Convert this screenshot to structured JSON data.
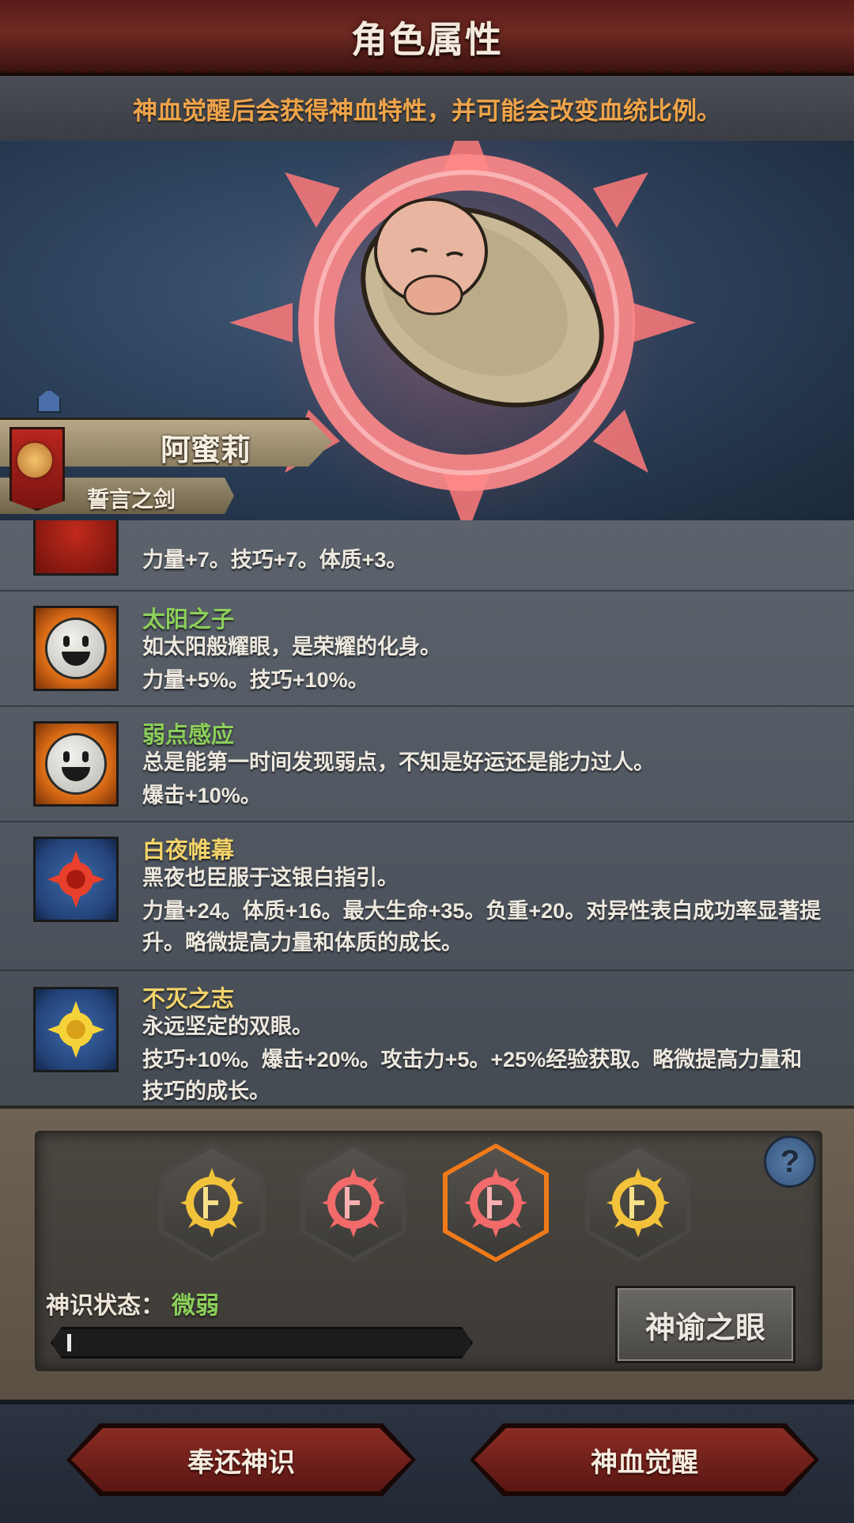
{
  "header": {
    "title": "角色属性"
  },
  "notice": {
    "text": "神血觉醒后会获得神血特性，并可能会改变血统比例。"
  },
  "character": {
    "name": "阿蜜莉",
    "title": "誓言之剑"
  },
  "traits": [
    {
      "name": "",
      "desc": "",
      "effect": "力量+7。技巧+7。体质+3。",
      "icon": "red-crest-icon"
    },
    {
      "name": "太阳之子",
      "desc": "如太阳般耀眼，是荣耀的化身。",
      "effect": "力量+5%。技巧+10%。",
      "icon": "smiley-sun-icon",
      "name_color": "#8ccf5a"
    },
    {
      "name": "弱点感应",
      "desc": "总是能第一时间发现弱点，不知是好运还是能力过人。",
      "effect": "爆击+10%。",
      "icon": "smiley-sun-icon",
      "name_color": "#8ccf5a"
    },
    {
      "name": "白夜帷幕",
      "desc": "黑夜也臣服于这银白指引。",
      "effect": "力量+24。体质+16。最大生命+35。负重+20。对异性表白成功率显著提升。略微提高力量和体质的成长。",
      "icon": "red-sun-emblem-icon",
      "name_color": "#f2d36a"
    },
    {
      "name": "不灭之志",
      "desc": "永远坚定的双眼。",
      "effect": "技巧+10%。爆击+20%。攻击力+5。+25%经验获取。略微提高力量和技巧的成长。",
      "icon": "gold-sun-emblem-icon",
      "name_color": "#f2d36a"
    }
  ],
  "awakening": {
    "slots": [
      {
        "type": "gold",
        "icon": "gold-sun-ring-icon"
      },
      {
        "type": "red",
        "icon": "red-sun-ring-icon"
      },
      {
        "type": "red",
        "icon": "red-sun-ring-icon",
        "selected": true
      },
      {
        "type": "gold",
        "icon": "gold-sun-ring-icon"
      }
    ],
    "help_symbol": "?",
    "state_label": "神识状态：",
    "state_value": "微弱",
    "progress": 0.01,
    "oracle_button": "神谕之眼"
  },
  "footer": {
    "return_button": "奉还神识",
    "awaken_button": "神血觉醒"
  },
  "colors": {
    "accent_orange": "#f0a44a",
    "green": "#8ccf5a",
    "gold": "#f2d36a",
    "header_red": "#6e2a22"
  }
}
